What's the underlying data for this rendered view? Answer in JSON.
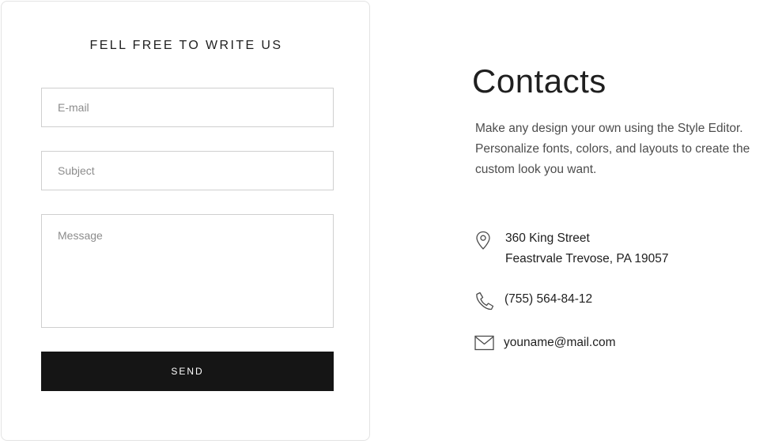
{
  "form": {
    "title": "FELL FREE TO WRITE US",
    "email_placeholder": "E-mail",
    "subject_placeholder": "Subject",
    "message_placeholder": "Message",
    "send_label": "SEND"
  },
  "contacts": {
    "title": "Contacts",
    "description": "Make any design your own using the Style Editor. Personalize fonts, colors, and layouts to create the custom look you want.",
    "address_line1": "360 King Street",
    "address_line2": "Feastrvale Trevose, PA 19057",
    "phone": "(755) 564-84-12",
    "email": "youname@mail.com",
    "icons": {
      "address": "map-pin-icon",
      "phone": "phone-icon",
      "email": "envelope-icon"
    }
  },
  "colors": {
    "button_bg": "#151515",
    "button_text": "#ffffff",
    "border": "#cfcfcf",
    "text": "#1f1f1f"
  }
}
